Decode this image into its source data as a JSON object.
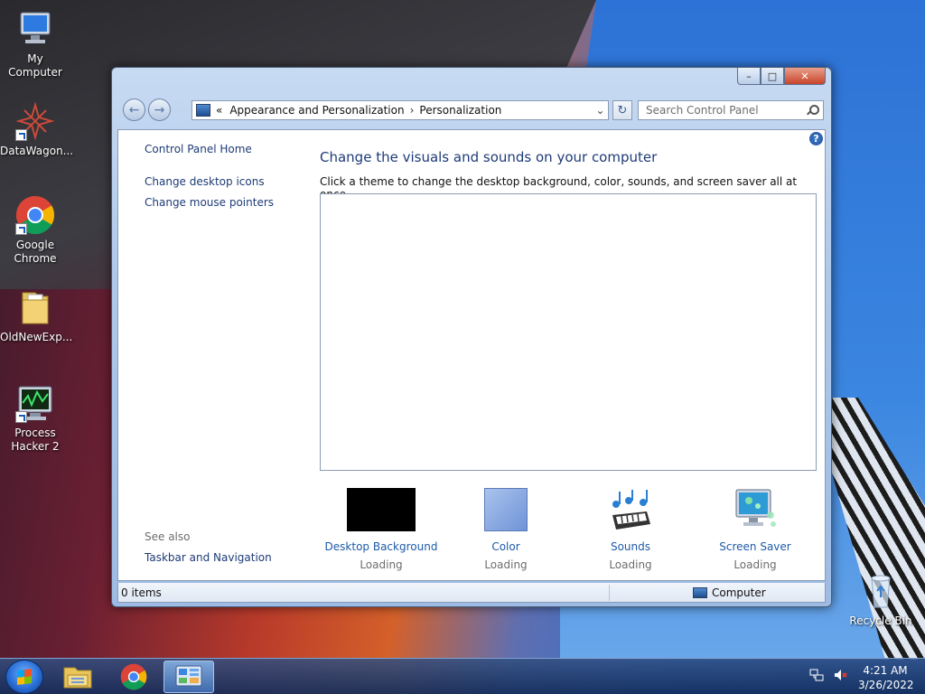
{
  "desktop": {
    "icons": [
      {
        "label": "My Computer"
      },
      {
        "label": "DataWagon..."
      },
      {
        "label": "Google Chrome"
      },
      {
        "label": "OldNewExp..."
      },
      {
        "label": "Process Hacker 2"
      },
      {
        "label": "Recycle Bin"
      }
    ]
  },
  "window": {
    "controls": {
      "minimize": "–",
      "maximize": "□",
      "close": "✕"
    },
    "nav": {
      "back": "←",
      "forward": "→"
    },
    "address": {
      "prefix": "«",
      "crumbs": [
        "Appearance and Personalization",
        "Personalization"
      ],
      "separator": "›"
    },
    "refresh": "↻",
    "search": {
      "placeholder": "Search Control Panel"
    },
    "help": "?",
    "left_pane": {
      "home": "Control Panel Home",
      "links": [
        "Change desktop icons",
        "Change mouse pointers"
      ],
      "see_also": "See also",
      "see_also_links": [
        "Taskbar and Navigation"
      ]
    },
    "main": {
      "title": "Change the visuals and sounds on your computer",
      "description": "Click a theme to change the desktop background, color, sounds, and screen saver all at once.",
      "options": [
        {
          "label": "Desktop Background",
          "status": "Loading"
        },
        {
          "label": "Color",
          "status": "Loading"
        },
        {
          "label": "Sounds",
          "status": "Loading"
        },
        {
          "label": "Screen Saver",
          "status": "Loading"
        }
      ]
    },
    "status_bar": {
      "items": "0 items",
      "location": "Computer"
    }
  },
  "taskbar": {
    "clock": {
      "time": "4:21 AM",
      "date": "3/26/2022"
    }
  },
  "colors": {
    "link": "#1e3b77",
    "accent_link": "#1e5aa8",
    "window_frame": "#aec8ea"
  }
}
